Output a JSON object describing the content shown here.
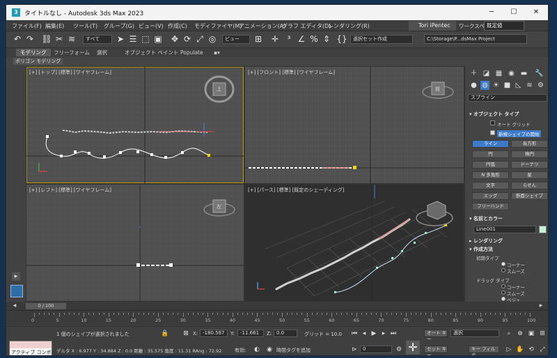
{
  "window": {
    "title": "タイトルなし - Autodesk 3ds Max 2023",
    "app_icon": "3",
    "minimize": "─",
    "maximize": "☐",
    "close": "✕"
  },
  "menu": [
    "ファイル(F)",
    "編集(E)",
    "ツール(T)",
    "グループ(G)",
    "ビュー(V)",
    "作成(C)",
    "モディファイヤ(M)",
    "アニメーション(A)",
    "グラフ エディタ(D)",
    "レンダリング(R)"
  ],
  "account": {
    "user": "Tori iPentec",
    "workspace_label": "ワークスペース:",
    "workspace_value": "既定値"
  },
  "toolbar": {
    "filter_select": "すべて",
    "view_select": "ビュー",
    "selection_set": "選択セット作成",
    "project_path": "C:\\Storage\\P...dsMax Project"
  },
  "ribbon": {
    "tabs": [
      "モデリング",
      "フリーフォーム",
      "選択",
      "オブジェクト ペイント",
      "Populate"
    ],
    "active_tab": "モデリング",
    "subpanel": "ポリゴン モデリング"
  },
  "viewports": {
    "top": "[+] [トップ] [標準] [ワイヤフレーム]",
    "front": "[+] [フロント] [標準] [ワイヤフレーム]",
    "left": "[+] [レフト] [標準] [ワイヤフレーム]",
    "persp": "[+] [パース] [標準] [既定のシェーディング]",
    "cube_top": "上",
    "cube_front": "前",
    "cube_left": "左"
  },
  "command_panel": {
    "category": "スプライン",
    "object_type_header": "オブジェクト タイプ",
    "auto_grid": "オート グリッド",
    "start_new_shape": "新規シェイプの開始",
    "buttons": [
      "ライン",
      "長方形",
      "円",
      "楕円",
      "円弧",
      "ドーナツ",
      "N 多角形",
      "星",
      "文字",
      "らせん",
      "エッグ",
      "断面シェイプ",
      "フリーハンド"
    ],
    "active_button": "ライン",
    "name_color_header": "名前とカラー",
    "object_name": "Line001",
    "object_color": "#c6f1d6",
    "rendering_header": "レンダリング",
    "creation_method_header": "作成方法",
    "initial_type_label": "初期タイプ",
    "initial_options": [
      "コーナー",
      "スムーズ"
    ],
    "initial_selected": "コーナー",
    "drag_type_label": "ドラッグ タイプ",
    "drag_options": [
      "コーナー",
      "スムーズ",
      "ベジェ"
    ],
    "drag_selected": "ベジェ"
  },
  "timeline": {
    "frame": "0 / 100",
    "ticks": [
      "0",
      "5",
      "10",
      "15",
      "20",
      "25",
      "30",
      "35",
      "40",
      "45",
      "50",
      "55",
      "60",
      "65",
      "70",
      "75",
      "80",
      "85",
      "90",
      "95",
      "100"
    ]
  },
  "status": {
    "maxscript": "アクティブ コンボ",
    "selection_msg": "1 個のシェイプが選択されました",
    "delta_msg": "デルタ X : 6.977  Y : 34.884  Z : 0.0  距離 : 35.575 角度 : 11.31 RAng : 72.92",
    "x_label": "X:",
    "x_value": "-180.587",
    "y_label": "Y:",
    "y_value": "-11.661",
    "z_label": "Z:",
    "z_value": "0.0",
    "grid": "グリッド = 10.0",
    "enabled": "有効:",
    "add_time_tag": "時間タグを追加",
    "auto_key": "オート キー",
    "set_key": "セット キー",
    "selected": "選択",
    "key_filters": "キー フィルタ...",
    "frame_field": "0"
  }
}
